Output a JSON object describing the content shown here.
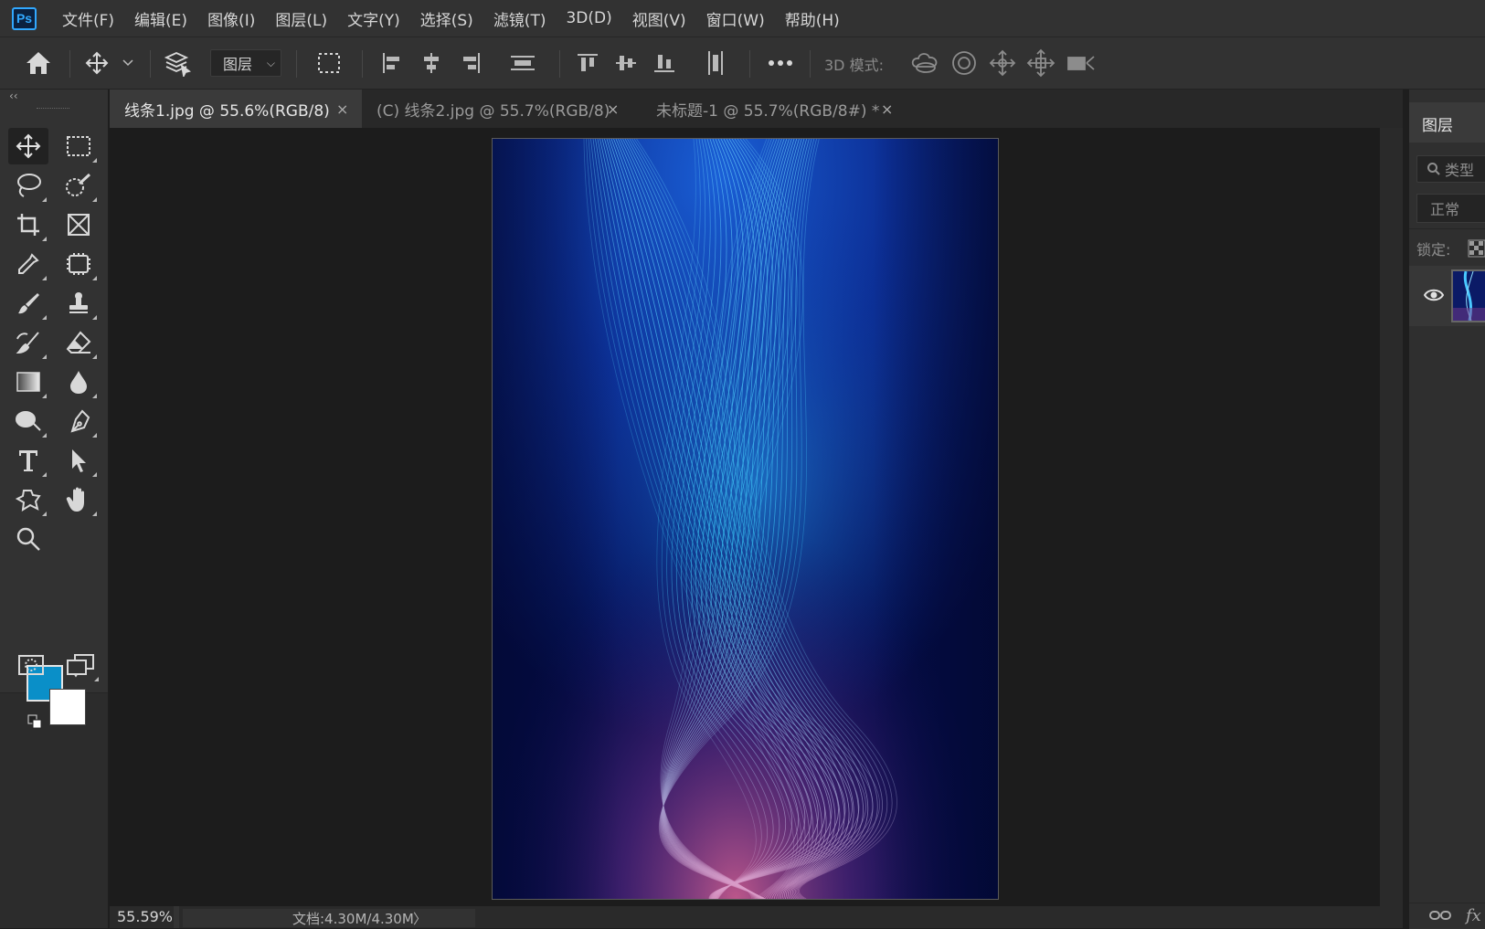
{
  "app": {
    "logo_text": "Ps"
  },
  "menu": [
    "文件(F)",
    "编辑(E)",
    "图像(I)",
    "图层(L)",
    "文字(Y)",
    "选择(S)",
    "滤镜(T)",
    "3D(D)",
    "视图(V)",
    "窗口(W)",
    "帮助(H)"
  ],
  "options_bar": {
    "auto_select_target": "图层",
    "mode3d_label": "3D 模式:",
    "icons": [
      "home-icon",
      "move-icon",
      "chevron-down-icon",
      "layers-stack-icon",
      "transform-controls-icon",
      "align-left-icon",
      "align-hcenter-icon",
      "align-right-icon",
      "distribute-horizontal-icon",
      "align-top-icon",
      "align-vcenter-icon",
      "align-bottom-icon",
      "distribute-vertical-icon",
      "more-icon",
      "orbit-3d-icon",
      "roll-3d-icon",
      "drag-3d-icon",
      "slide-3d-icon",
      "camera-zoom-3d-icon"
    ]
  },
  "tools": [
    "move-tool",
    "marquee-tool",
    "lasso-tool",
    "quick-select-tool",
    "crop-tool",
    "frame-tool",
    "eyedropper-tool",
    "spot-heal-tool",
    "brush-tool",
    "clone-stamp-tool",
    "history-brush-tool",
    "eraser-tool",
    "gradient-tool",
    "blur-tool",
    "dodge-tool",
    "pen-tool",
    "type-tool",
    "path-select-tool",
    "shape-tool",
    "hand-tool",
    "zoom-tool",
    "quick-mask-tool",
    "screen-mode-tool"
  ],
  "colors": {
    "foreground": "#0a8fc8",
    "background": "#ffffff"
  },
  "tabs": [
    {
      "label": "线条1.jpg @ 55.6%(RGB/8)",
      "close": "×",
      "active": true
    },
    {
      "label": "(C) 线条2.jpg @ 55.7%(RGB/8)",
      "close": "×",
      "active": false
    },
    {
      "label": "未标题-1 @ 55.7%(RGB/8#) *",
      "close": "×",
      "active": false
    }
  ],
  "status": {
    "zoom": "55.59%",
    "doc_info": "文档:4.30M/4.30M",
    "arrow": "〉"
  },
  "layers_panel": {
    "tab_label": "图层",
    "search_placeholder": "类型",
    "blend_mode": "正常",
    "lock_label": "锁定:",
    "layer_visibility_icon": "eye-icon"
  }
}
